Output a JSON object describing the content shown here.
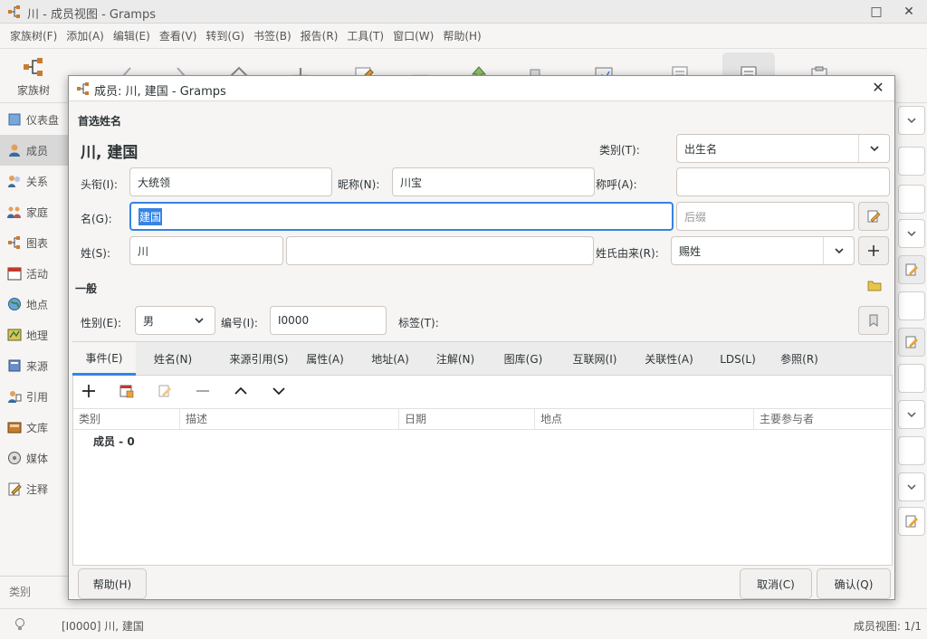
{
  "main_window": {
    "title": "川 - 成员视图 - Gramps",
    "menu": [
      "家族树(F)",
      "添加(A)",
      "编辑(E)",
      "查看(V)",
      "转到(G)",
      "书签(B)",
      "报告(R)",
      "工具(T)",
      "窗口(W)",
      "帮助(H)"
    ],
    "toolbar": {
      "family_tree_label": "家族树"
    },
    "sidebar": {
      "items": [
        "仪表盘",
        "成员",
        "关系",
        "家庭",
        "图表",
        "活动",
        "地点",
        "地理",
        "来源",
        "引用",
        "文库",
        "媒体",
        "注释"
      ],
      "selected": "成员",
      "category_label": "类别"
    },
    "status": {
      "left": "[I0000] 川, 建国",
      "right": "成员视图: 1/1"
    }
  },
  "dialog": {
    "title": "成员: 川, 建国 - Gramps",
    "preferred_name_header": "首选姓名",
    "display_name": "川, 建国",
    "type_label": "类别(T):",
    "type_value": "出生名",
    "title_label": "头衔(I):",
    "title_value": "大统领",
    "nick_label": "昵称(N):",
    "nick_value": "川宝",
    "call_label": "称呼(A):",
    "call_value": "",
    "given_label": "名(G):",
    "given_value": "建国",
    "suffix_placeholder": "后缀",
    "surname_label": "姓(S):",
    "surname_value": "川",
    "origin_label": "姓氏由来(R):",
    "origin_value": "赐姓",
    "general_header": "一般",
    "gender_label": "性别(E):",
    "gender_value": "男",
    "id_label": "编号(I):",
    "id_value": "I0000",
    "tags_label": "标签(T):",
    "tabs": [
      "事件(E)",
      "姓名(N)",
      "来源引用(S)",
      "属性(A)",
      "地址(A)",
      "注解(N)",
      "图库(G)",
      "互联网(I)",
      "关联性(A)",
      "LDS(L)",
      "参照(R)"
    ],
    "active_tab": "事件(E)",
    "columns": [
      "类别",
      "描述",
      "日期",
      "地点",
      "主要参与者"
    ],
    "group_row": "成员 - 0",
    "buttons": {
      "help": "帮助(H)",
      "cancel": "取消(C)",
      "ok": "确认(Q)"
    }
  },
  "colors": {
    "accent": "#3584e4",
    "window_bg": "#f6f5f4"
  }
}
